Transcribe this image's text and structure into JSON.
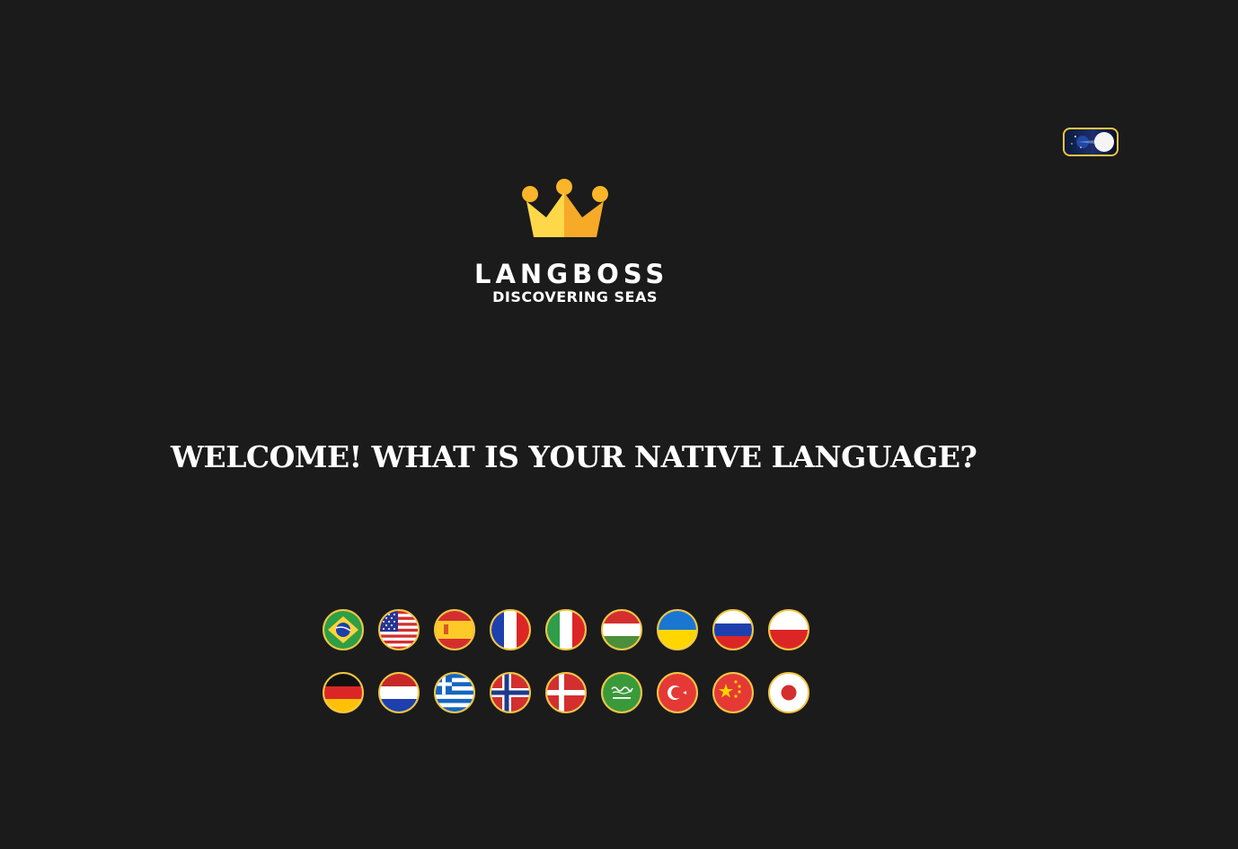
{
  "header": {
    "theme_toggle_label": "theme-toggle",
    "theme_icon": "moon-icon"
  },
  "logo": {
    "icon": "crown-icon",
    "brand": "LANGBOSS",
    "tagline": "DISCOVERING SEAS"
  },
  "main": {
    "heading": "WELCOME! WHAT IS YOUR NATIVE LANGUAGE?"
  },
  "languages": [
    {
      "flag": "brazil-flag-icon",
      "country": "Brazil"
    },
    {
      "flag": "usa-flag-icon",
      "country": "United States"
    },
    {
      "flag": "spain-flag-icon",
      "country": "Spain"
    },
    {
      "flag": "france-flag-icon",
      "country": "France"
    },
    {
      "flag": "italy-flag-icon",
      "country": "Italy"
    },
    {
      "flag": "hungary-flag-icon",
      "country": "Hungary"
    },
    {
      "flag": "ukraine-flag-icon",
      "country": "Ukraine"
    },
    {
      "flag": "russia-flag-icon",
      "country": "Russia"
    },
    {
      "flag": "poland-flag-icon",
      "country": "Poland"
    },
    {
      "flag": "germany-flag-icon",
      "country": "Germany"
    },
    {
      "flag": "netherlands-flag-icon",
      "country": "Netherlands"
    },
    {
      "flag": "greece-flag-icon",
      "country": "Greece"
    },
    {
      "flag": "norway-flag-icon",
      "country": "Norway"
    },
    {
      "flag": "denmark-flag-icon",
      "country": "Denmark"
    },
    {
      "flag": "saudi-arabia-flag-icon",
      "country": "Saudi Arabia"
    },
    {
      "flag": "turkey-flag-icon",
      "country": "Turkey"
    },
    {
      "flag": "china-flag-icon",
      "country": "China"
    },
    {
      "flag": "japan-flag-icon",
      "country": "Japan"
    }
  ],
  "colors": {
    "background": "#1b1b1b",
    "accent_border": "#f2c53d",
    "crown": "#fbc02d",
    "text": "#ffffff"
  }
}
